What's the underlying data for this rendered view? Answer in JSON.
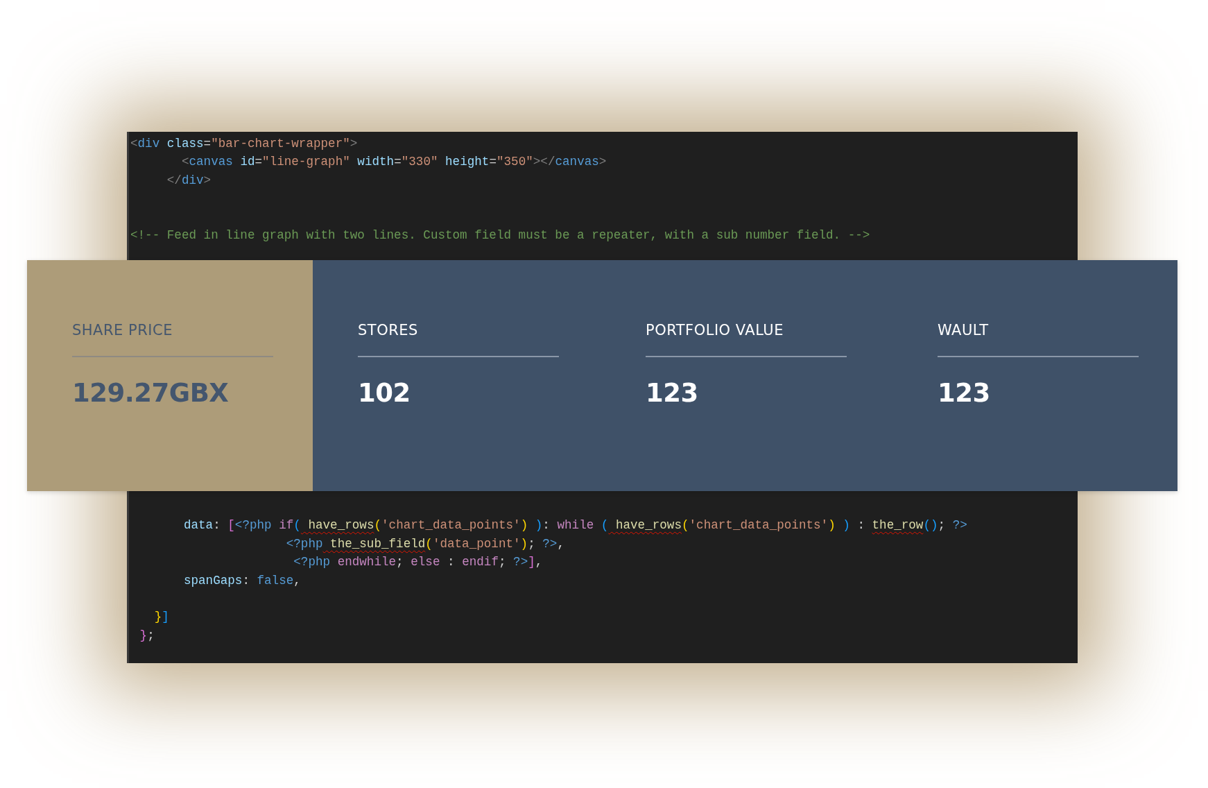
{
  "editor": {
    "lines_above": [
      {
        "kind": "code",
        "tokens": [
          {
            "kind": "punct",
            "text": "<"
          },
          {
            "kind": "tag",
            "text": "div"
          },
          {
            "kind": "attr",
            "text": " class"
          },
          {
            "kind": "text",
            "text": "="
          },
          {
            "kind": "string",
            "text": "\"bar-chart-wrapper\""
          },
          {
            "kind": "punct",
            "text": ">"
          }
        ]
      },
      {
        "kind": "code",
        "tokens": [
          {
            "kind": "punct",
            "text": "       <"
          },
          {
            "kind": "tag",
            "text": "canvas"
          },
          {
            "kind": "attr",
            "text": " id"
          },
          {
            "kind": "text",
            "text": "="
          },
          {
            "kind": "string",
            "text": "\"line-graph\""
          },
          {
            "kind": "attr",
            "text": " width"
          },
          {
            "kind": "text",
            "text": "="
          },
          {
            "kind": "string",
            "text": "\"330\""
          },
          {
            "kind": "attr",
            "text": " height"
          },
          {
            "kind": "text",
            "text": "="
          },
          {
            "kind": "string",
            "text": "\"350\""
          },
          {
            "kind": "punct",
            "text": "></"
          },
          {
            "kind": "tag",
            "text": "canvas"
          },
          {
            "kind": "punct",
            "text": ">"
          }
        ]
      },
      {
        "kind": "code",
        "tokens": [
          {
            "kind": "punct",
            "text": "     </"
          },
          {
            "kind": "tag",
            "text": "div"
          },
          {
            "kind": "punct",
            "text": ">"
          }
        ]
      },
      {
        "kind": "blank"
      },
      {
        "kind": "blank"
      },
      {
        "kind": "code",
        "tokens": [
          {
            "kind": "comment",
            "text": "<!-- Feed in line graph with two lines. Custom field must be a repeater, with a sub number field. -->"
          }
        ]
      }
    ],
    "lines_below": [
      {
        "kind": "blank"
      },
      {
        "kind": "code",
        "tokens": [
          {
            "kind": "attr",
            "text": "       data"
          },
          {
            "kind": "text",
            "text": ": "
          },
          {
            "kind": "bracket2",
            "text": "["
          },
          {
            "kind": "php",
            "text": "<?php"
          },
          {
            "kind": "keyword",
            "text": " if"
          },
          {
            "kind": "bracket3",
            "text": "("
          },
          {
            "kind": "func",
            "text": " have_rows",
            "error": true
          },
          {
            "kind": "bracket1",
            "text": "("
          },
          {
            "kind": "string",
            "text": "'chart_data_points'"
          },
          {
            "kind": "bracket1",
            "text": ")"
          },
          {
            "kind": "bracket3",
            "text": " )"
          },
          {
            "kind": "text",
            "text": ": "
          },
          {
            "kind": "keyword",
            "text": "while"
          },
          {
            "kind": "bracket3",
            "text": " ("
          },
          {
            "kind": "func",
            "text": " have_rows",
            "error": true
          },
          {
            "kind": "bracket1",
            "text": "("
          },
          {
            "kind": "string",
            "text": "'chart_data_points'"
          },
          {
            "kind": "bracket1",
            "text": ")"
          },
          {
            "kind": "bracket3",
            "text": " )"
          },
          {
            "kind": "text",
            "text": " : "
          },
          {
            "kind": "func",
            "text": "the_row",
            "error": true
          },
          {
            "kind": "bracket3",
            "text": "()"
          },
          {
            "kind": "text",
            "text": "; "
          },
          {
            "kind": "php",
            "text": "?>"
          }
        ]
      },
      {
        "kind": "code",
        "tokens": [
          {
            "kind": "php",
            "text": "                     <?php"
          },
          {
            "kind": "func",
            "text": " the_sub_field",
            "error": true
          },
          {
            "kind": "bracket1",
            "text": "("
          },
          {
            "kind": "string",
            "text": "'data_point'"
          },
          {
            "kind": "bracket1",
            "text": ")"
          },
          {
            "kind": "text",
            "text": "; "
          },
          {
            "kind": "php",
            "text": "?>"
          },
          {
            "kind": "text",
            "text": ","
          }
        ]
      },
      {
        "kind": "code",
        "tokens": [
          {
            "kind": "php",
            "text": "                      <?php"
          },
          {
            "kind": "keyword",
            "text": " endwhile"
          },
          {
            "kind": "text",
            "text": "; "
          },
          {
            "kind": "keyword",
            "text": "else"
          },
          {
            "kind": "text",
            "text": " : "
          },
          {
            "kind": "keyword",
            "text": "endif"
          },
          {
            "kind": "text",
            "text": "; "
          },
          {
            "kind": "php",
            "text": "?>"
          },
          {
            "kind": "bracket2",
            "text": "]"
          },
          {
            "kind": "text",
            "text": ","
          }
        ]
      },
      {
        "kind": "code",
        "tokens": [
          {
            "kind": "attr",
            "text": "       spanGaps"
          },
          {
            "kind": "text",
            "text": ": "
          },
          {
            "kind": "const",
            "text": "false"
          },
          {
            "kind": "text",
            "text": ","
          }
        ]
      },
      {
        "kind": "blank"
      },
      {
        "kind": "code",
        "tokens": [
          {
            "kind": "bracket1",
            "text": "   }"
          },
          {
            "kind": "bracket3",
            "text": "]"
          }
        ]
      },
      {
        "kind": "code",
        "tokens": [
          {
            "kind": "bracket2",
            "text": " }"
          },
          {
            "kind": "text",
            "text": ";"
          }
        ]
      }
    ]
  },
  "stats_panel": {
    "featured": {
      "label": "SHARE PRICE",
      "value": "129.27GBX"
    },
    "stats": [
      {
        "label": "STORES",
        "value": "102"
      },
      {
        "label": "PORTFOLIO VALUE",
        "value": "123"
      },
      {
        "label": "WAULT",
        "value": "123"
      }
    ]
  }
}
